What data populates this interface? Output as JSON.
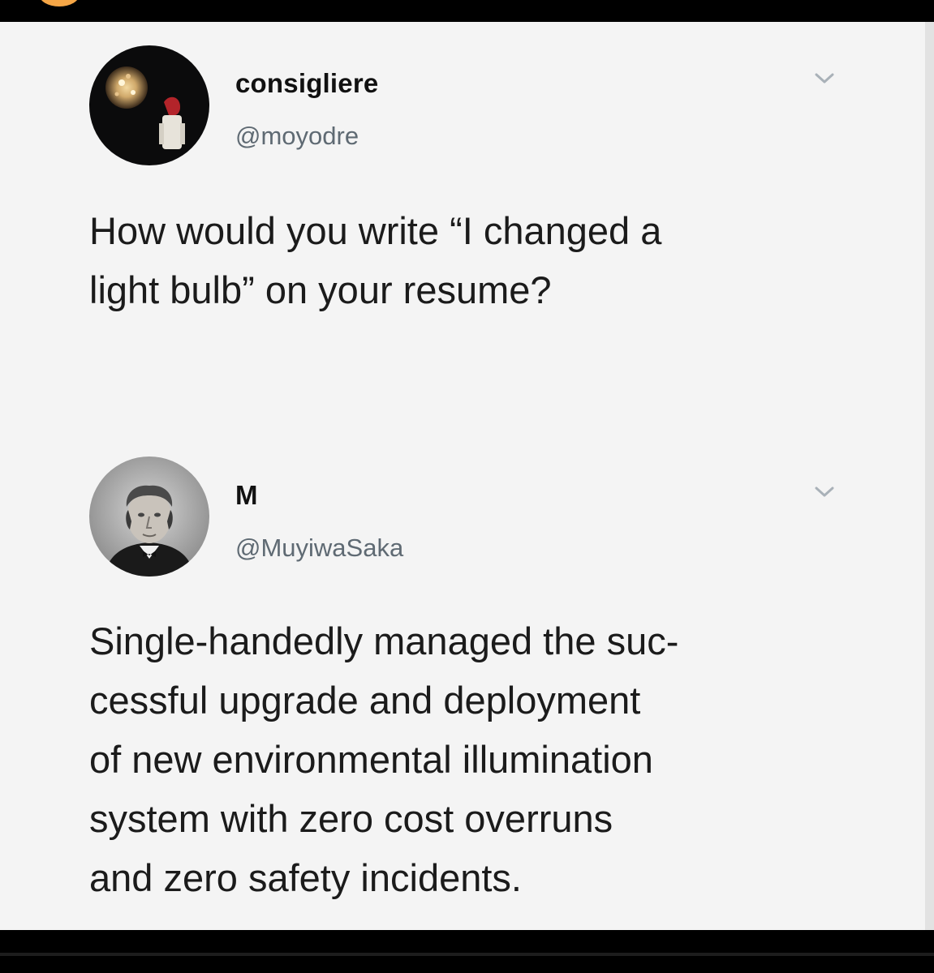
{
  "tweets": [
    {
      "display_name": "consigliere",
      "handle": "@moyodre",
      "avatar_icon": "user-avatar-icon",
      "menu_icon": "chevron-down-icon",
      "body_lines": [
        "How would you write “I changed a",
        "light bulb” on your resume?"
      ]
    },
    {
      "display_name": "M",
      "handle": "@MuyiwaSaka",
      "avatar_icon": "user-avatar-icon",
      "menu_icon": "chevron-down-icon",
      "body_lines": [
        "Single-handedly managed the suc-",
        "cessful upgrade and deployment",
        "of new environmental illumination",
        "system with zero cost overruns",
        "and zero safety incidents."
      ]
    }
  ],
  "colors": {
    "background": "#f4f4f4",
    "text": "#1b1b1b",
    "handle": "#5f6a73",
    "frame": "#000000",
    "accent_top": "#f5a646"
  }
}
